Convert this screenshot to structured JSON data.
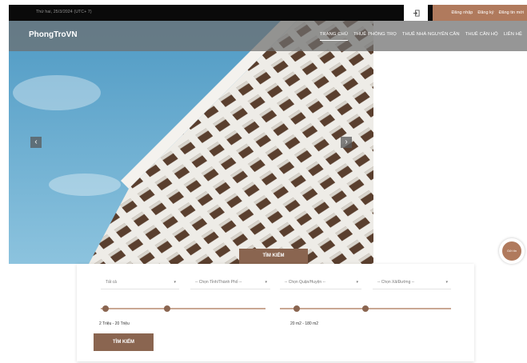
{
  "topbar": {
    "date": "Thứ hai, 25/3/2024 (UTC+ 7)",
    "login_icon": "login-icon",
    "links": [
      "Đăng nhập",
      "Đăng ký",
      "Đăng tin mới"
    ]
  },
  "nav": {
    "brand": "PhongTroVN",
    "items": [
      "TRANG CHỦ",
      "THUÊ PHÒNG TRỌ",
      "THUÊ NHÀ NGUYÊN CĂN",
      "THUÊ CĂN HỘ",
      "LIÊN HỆ"
    ],
    "active_index": 0
  },
  "carousel": {
    "prev_icon": "chevron-left-icon",
    "next_icon": "chevron-right-icon"
  },
  "search": {
    "tab_label": "TÌM KIẾM",
    "selects": [
      "Tất cả",
      "-- Chọn Tỉnh/Thành Phố --",
      "-- Chọn Quận/Huyện --",
      "-- Chọn Xã/Đường --"
    ],
    "price": {
      "label": "2 Triệu - 20 Triệu",
      "min": 2,
      "max": 20,
      "unit": "Triệu"
    },
    "area": {
      "label": "20 m2 - 180 m2",
      "min": 20,
      "max": 180,
      "unit": "m2"
    },
    "button_label": "TÌM KIẾM"
  },
  "chat": {
    "label": "Gửi tin"
  },
  "colors": {
    "accent": "#8a6550",
    "auth_bg": "#b07a5d",
    "topbar": "#0a0a0a"
  }
}
